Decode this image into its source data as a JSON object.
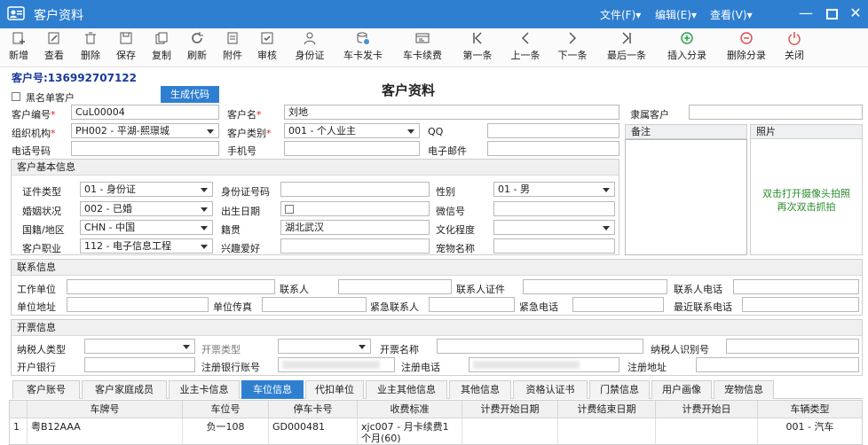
{
  "window": {
    "title": "客户资料",
    "menu": [
      "文件(F)▾",
      "编辑(E)▾",
      "查看(V)▾"
    ]
  },
  "toolbar": [
    {
      "label": "新增",
      "icon": "add-icon"
    },
    {
      "label": "查看",
      "icon": "view-icon"
    },
    {
      "label": "删除",
      "icon": "delete-icon"
    },
    {
      "label": "保存",
      "icon": "save-icon"
    },
    {
      "label": "复制",
      "icon": "copy-icon"
    },
    {
      "label": "刷新",
      "icon": "refresh-icon"
    },
    {
      "label": "附件",
      "icon": "attachment-icon"
    },
    {
      "label": "审核",
      "icon": "audit-icon"
    },
    {
      "label": "身份证",
      "icon": "id-card-icon"
    },
    {
      "label": "车卡发卡",
      "icon": "issue-card-icon"
    },
    {
      "label": "车卡续费",
      "icon": "renew-card-icon"
    },
    {
      "label": "第一条",
      "icon": "first-record-icon"
    },
    {
      "label": "上一条",
      "icon": "previous-record-icon"
    },
    {
      "label": "下一条",
      "icon": "next-record-icon"
    },
    {
      "label": "最后一条",
      "icon": "last-record-icon"
    },
    {
      "label": "插入分录",
      "icon": "insert-entry-icon"
    },
    {
      "label": "删除分录",
      "icon": "delete-entry-icon"
    },
    {
      "label": "关闭",
      "icon": "close-power-icon"
    }
  ],
  "customer_no": "客户号:136992707122",
  "form_title": "客户资料",
  "blacklist_label": "黑名单客户",
  "generate_code": "生成代码",
  "fields": {
    "cust_code_label": "客户编号",
    "cust_code": "CuL00004",
    "cust_name_label": "客户名",
    "cust_name": "刘地",
    "belong_label": "隶属客户",
    "org_label": "组织机构",
    "org": "PH002 - 平湖-熙璟城",
    "cust_type_label": "客户类别",
    "cust_type": "001 - 个人业主",
    "qq_label": "QQ",
    "phone_label": "电话号码",
    "mobile_label": "手机号",
    "email_label": "电子邮件",
    "remark_label": "备注",
    "photo_label": "照片",
    "photo_tip1": "双击打开摄像头拍照",
    "photo_tip2": "再次双击抓拍"
  },
  "basic": {
    "title": "客户基本信息",
    "id_type_label": "证件类型",
    "id_type": "01 - 身份证",
    "id_no_label": "身份证号码",
    "gender_label": "性别",
    "gender": "01 - 男",
    "marital_label": "婚姻状况",
    "marital": "002 - 已婚",
    "birth_label": "出生日期",
    "wechat_label": "微信号",
    "nation_label": "国籍/地区",
    "nation": "CHN - 中国",
    "native_label": "籍贯",
    "native": "湖北武汉",
    "edu_label": "文化程度",
    "job_label": "客户职业",
    "job": "112 - 电子信息工程",
    "hobby_label": "兴趣爱好",
    "pet_label": "宠物名称"
  },
  "contact": {
    "title": "联系信息",
    "work_label": "工作单位",
    "person_label": "联系人",
    "person_id_label": "联系人证件",
    "person_phone_label": "联系人电话",
    "addr_label": "单位地址",
    "fax_label": "单位传真",
    "emer_label": "紧急联系人",
    "emer_phone_label": "紧急电话",
    "recent_label": "最近联系电话"
  },
  "invoice": {
    "title": "开票信息",
    "taxpayer_type_label": "纳税人类型",
    "inv_type_label": "开票类型",
    "inv_name_label": "开票名称",
    "taxpayer_id_label": "纳税人识别号",
    "bank_label": "开户银行",
    "bank_acct_label": "注册银行账号",
    "reg_phone_label": "注册电话",
    "reg_addr_label": "注册地址"
  },
  "tabs": [
    "客户账号",
    "客户家庭成员",
    "业主卡信息",
    "车位信息",
    "代扣单位",
    "业主其他信息",
    "其他信息",
    "资格认证书",
    "门禁信息",
    "用户画像",
    "宠物信息"
  ],
  "active_tab": "车位信息",
  "grid": {
    "columns": [
      "车牌号",
      "车位号",
      "停车卡号",
      "收费标准",
      "计费开始日期",
      "计费结束日期",
      "计费开始日",
      "车辆类型"
    ],
    "rows": [
      [
        "1",
        "粤B12AAA",
        "负一108",
        "GD000481",
        "xjc007 - 月卡续费1个月(60)",
        "",
        "",
        "",
        "001 - 汽车"
      ]
    ]
  }
}
